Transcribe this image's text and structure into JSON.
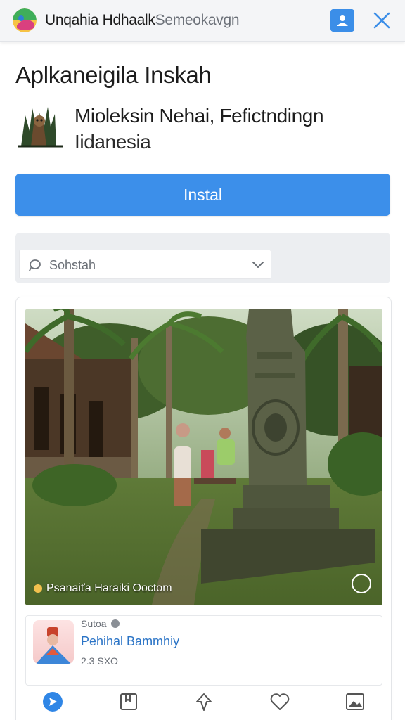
{
  "topbar": {
    "title_main": "Unqahia Hdhaalk",
    "title_sub": "Semeokavgn",
    "share_icon": "share-person-icon",
    "close_icon": "close-icon"
  },
  "page": {
    "title": "Aplkaneigila Inskah"
  },
  "app": {
    "name_line1": "Miolеksin Nehai, Fefictndingn",
    "name_line2": "Iidanesia",
    "icon": "app-figure-icon"
  },
  "install": {
    "label": "Instal"
  },
  "search": {
    "placeholder": "Sohstah"
  },
  "card": {
    "photo_caption": "Psanaiťa Haraiki Ooctom",
    "info_label": "Sutoa",
    "info_title": "Pehihal Bammhiy",
    "info_meta": "2.3 SXO"
  },
  "actions": [
    {
      "icon": "send-icon"
    },
    {
      "icon": "bookmark-icon"
    },
    {
      "icon": "pin-icon"
    },
    {
      "icon": "heart-icon"
    },
    {
      "icon": "image-icon"
    }
  ],
  "colors": {
    "accent": "#3c8fea",
    "link": "#2b74c6",
    "topbar": "#f4f5f7"
  }
}
